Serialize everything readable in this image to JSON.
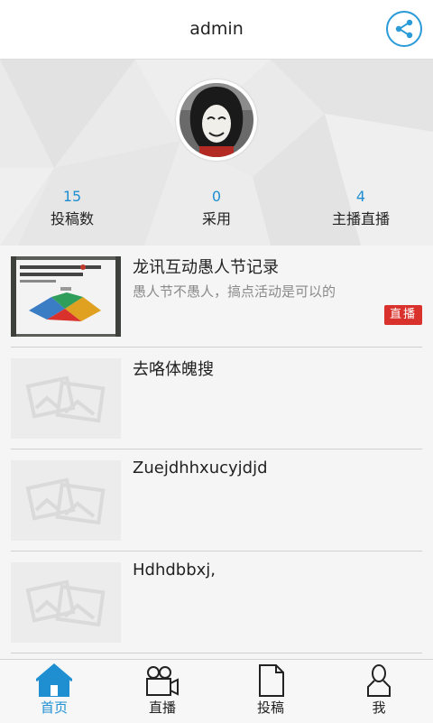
{
  "header": {
    "title": "admin",
    "share_icon": "share-icon"
  },
  "profile": {
    "avatar_icon": "user-avatar",
    "stats": [
      {
        "value": "15",
        "label": "投稿数"
      },
      {
        "value": "0",
        "label": "采用"
      },
      {
        "value": "4",
        "label": "主播直播"
      }
    ]
  },
  "list": {
    "items": [
      {
        "title": "龙讯互动愚人节记录",
        "desc": "愚人节不愚人，搞点活动是可以的",
        "badge": "直播",
        "thumb": "photo"
      },
      {
        "title": "去咯体魄搜",
        "desc": "",
        "badge": "",
        "thumb": "image-placeholder-icon"
      },
      {
        "title": "Zuejdhhxucyjdjd",
        "desc": "",
        "badge": "",
        "thumb": "image-placeholder-icon"
      },
      {
        "title": "Hdhdbbxj,",
        "desc": "",
        "badge": "",
        "thumb": "image-placeholder-icon"
      }
    ]
  },
  "tabbar": {
    "active": "首页",
    "tabs": [
      {
        "label": "首页",
        "icon": "home-icon"
      },
      {
        "label": "直播",
        "icon": "video-camera-icon"
      },
      {
        "label": "投稿",
        "icon": "document-icon"
      },
      {
        "label": "我",
        "icon": "person-icon"
      }
    ]
  },
  "colors": {
    "accent": "#1f8fd2",
    "badge": "#d9322d"
  }
}
